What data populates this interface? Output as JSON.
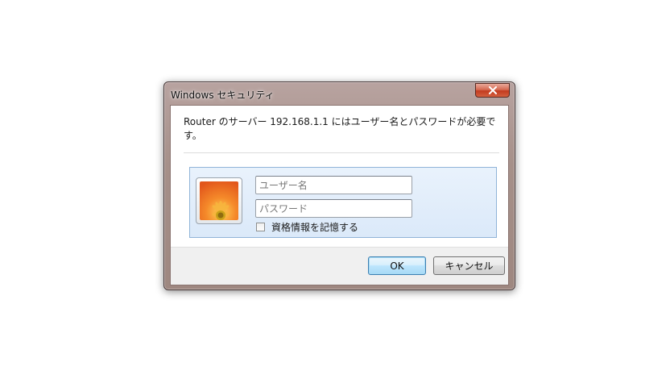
{
  "window": {
    "title": "Windows セキュリティ",
    "close_icon": "close-icon"
  },
  "dialog": {
    "message": "Router のサーバー 192.168.1.1 にはユーザー名とパスワードが必要です。",
    "username": {
      "placeholder": "ユーザー名",
      "value": ""
    },
    "password": {
      "placeholder": "パスワード",
      "value": ""
    },
    "remember": {
      "label": "資格情報を記憶する",
      "checked": false
    },
    "user_tile_icon": "user-tile-flower-icon"
  },
  "buttons": {
    "ok_label": "OK",
    "cancel_label": "キャンセル"
  },
  "colors": {
    "frame": "#a69089",
    "close_button": "#c23b1f",
    "credential_panel": "#dbe9f9",
    "default_button_border": "#3c7fb1"
  }
}
